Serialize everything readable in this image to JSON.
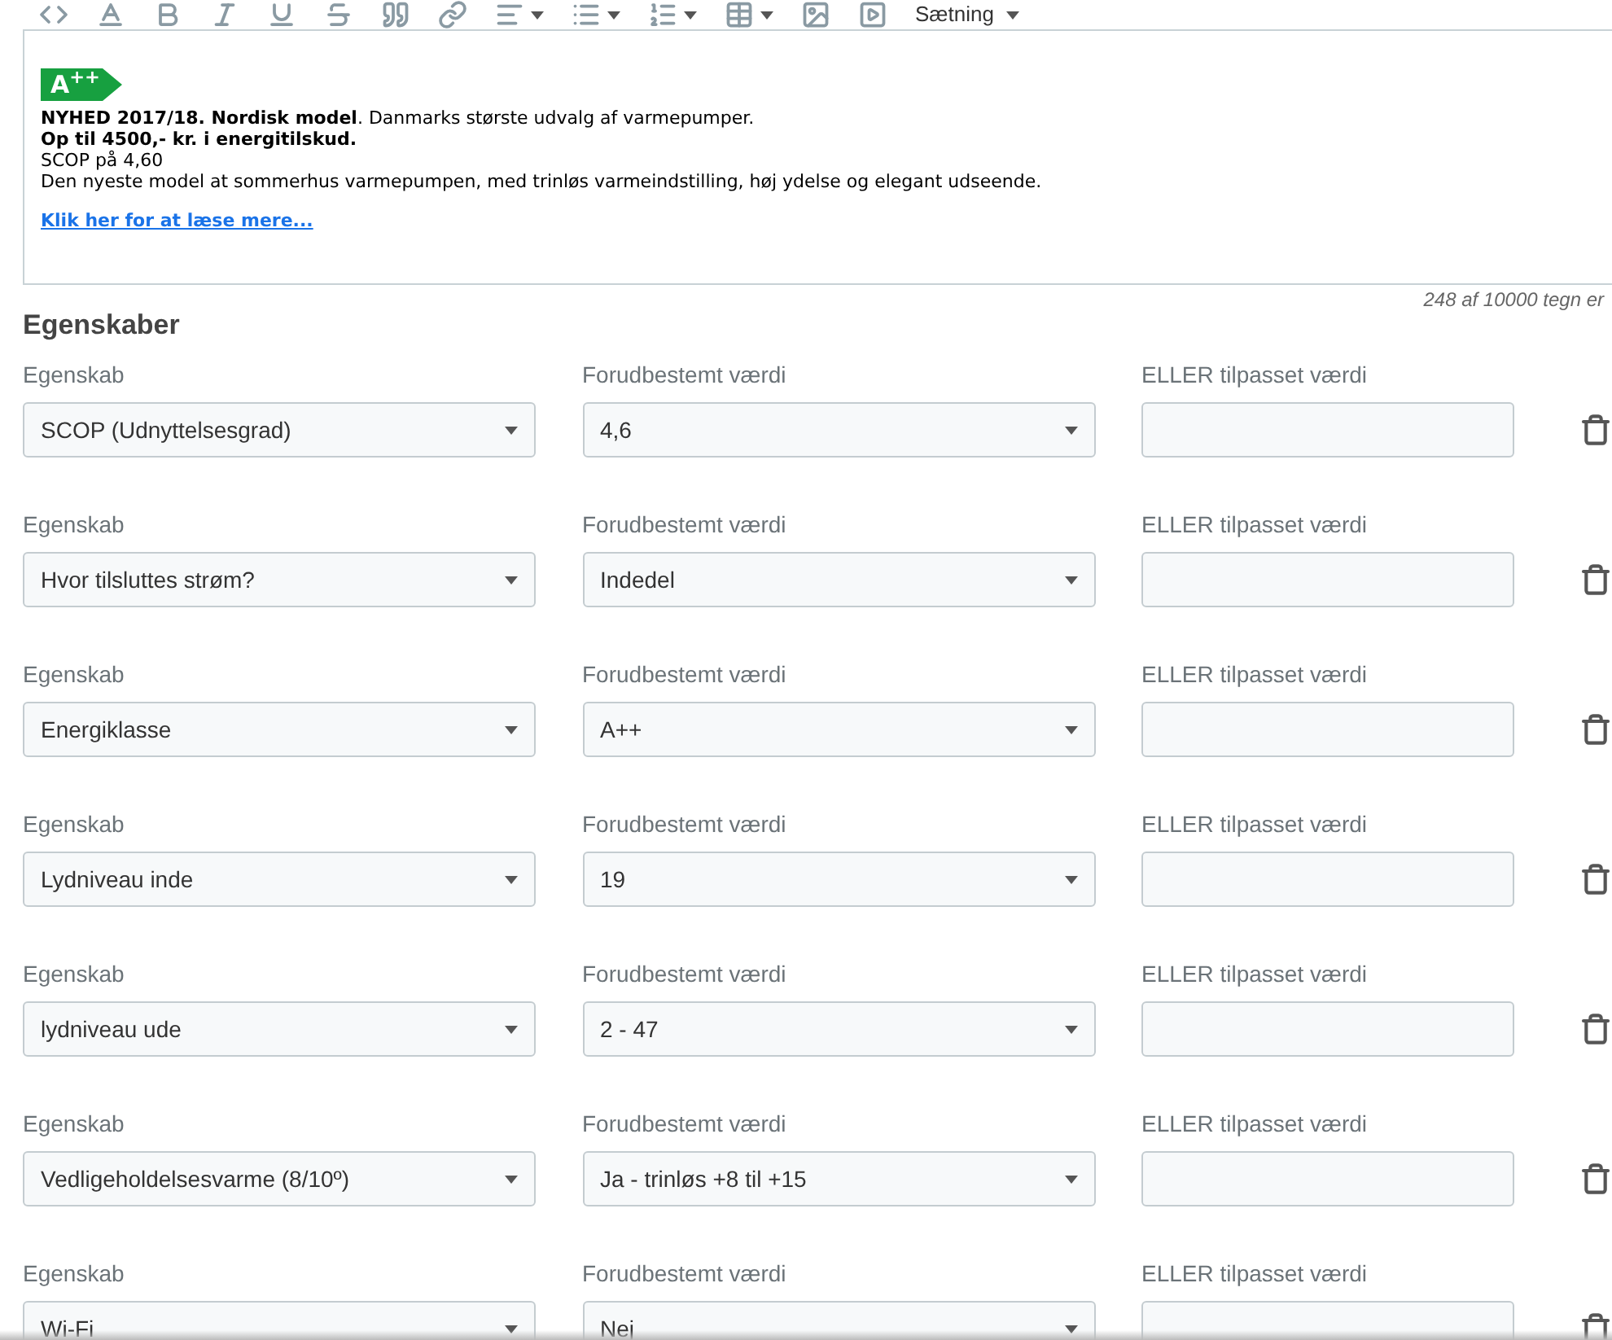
{
  "toolbar": {
    "format_dropdown": "Sætning"
  },
  "editor": {
    "badge": "A$^{++}$",
    "lines": [
      "**NYHED 2017/18. Nordisk model**. Danmarks største udvalg af varmepumper.",
      "**Op til 4500,- kr. i energitilskud.**",
      "SCOP på 4,60",
      "Den nyeste model at sommerhus varmepumpen, med trinløs varmeindstilling, høj ydelse og elegant udseende."
    ],
    "link": "Klik her for at læse mere..."
  },
  "char_counter": "248 af 10000 tegn er",
  "section_title": "Egenskaber",
  "properties": [
    {
      "property_label": "Egenskab",
      "property": "SCOP (Udnyttelsesgrad)",
      "preset_label": "Forudbestemt værdi",
      "preset": "4,6",
      "custom_label": "ELLER tilpasset værdi"
    },
    {
      "property_label": "Egenskab",
      "property": "Hvor tilsluttes strøm?",
      "preset_label": "Forudbestemt værdi",
      "preset": "Indedel",
      "custom_label": "ELLER tilpasset værdi"
    },
    {
      "property_label": "Egenskab",
      "property": "Energiklasse",
      "preset_label": "Forudbestemt værdi",
      "preset": "A++",
      "custom_label": "ELLER tilpasset værdi"
    },
    {
      "property_label": "Egenskab",
      "property": "Lydniveau inde",
      "preset_label": "Forudbestemt værdi",
      "preset": "19",
      "custom_label": "ELLER tilpasset værdi"
    },
    {
      "property_label": "Egenskab",
      "property": "lydniveau ude",
      "preset_label": "Forudbestemt værdi",
      "preset": "2 - 47",
      "custom_label": "ELLER tilpasset værdi"
    },
    {
      "property_label": "Egenskab",
      "property": "Vedligeholdelsesvarme (8/10º)",
      "preset_label": "Forudbestemt værdi",
      "preset": "Ja - trinløs +8 til +15",
      "custom_label": "ELLER tilpasset værdi"
    },
    {
      "property_label": "Egenskab",
      "property": "Wi-Fi",
      "preset_label": "Forudbestemt værdi",
      "preset": "Nej",
      "custom_label": "ELLER tilpasset værdi"
    }
  ]
}
